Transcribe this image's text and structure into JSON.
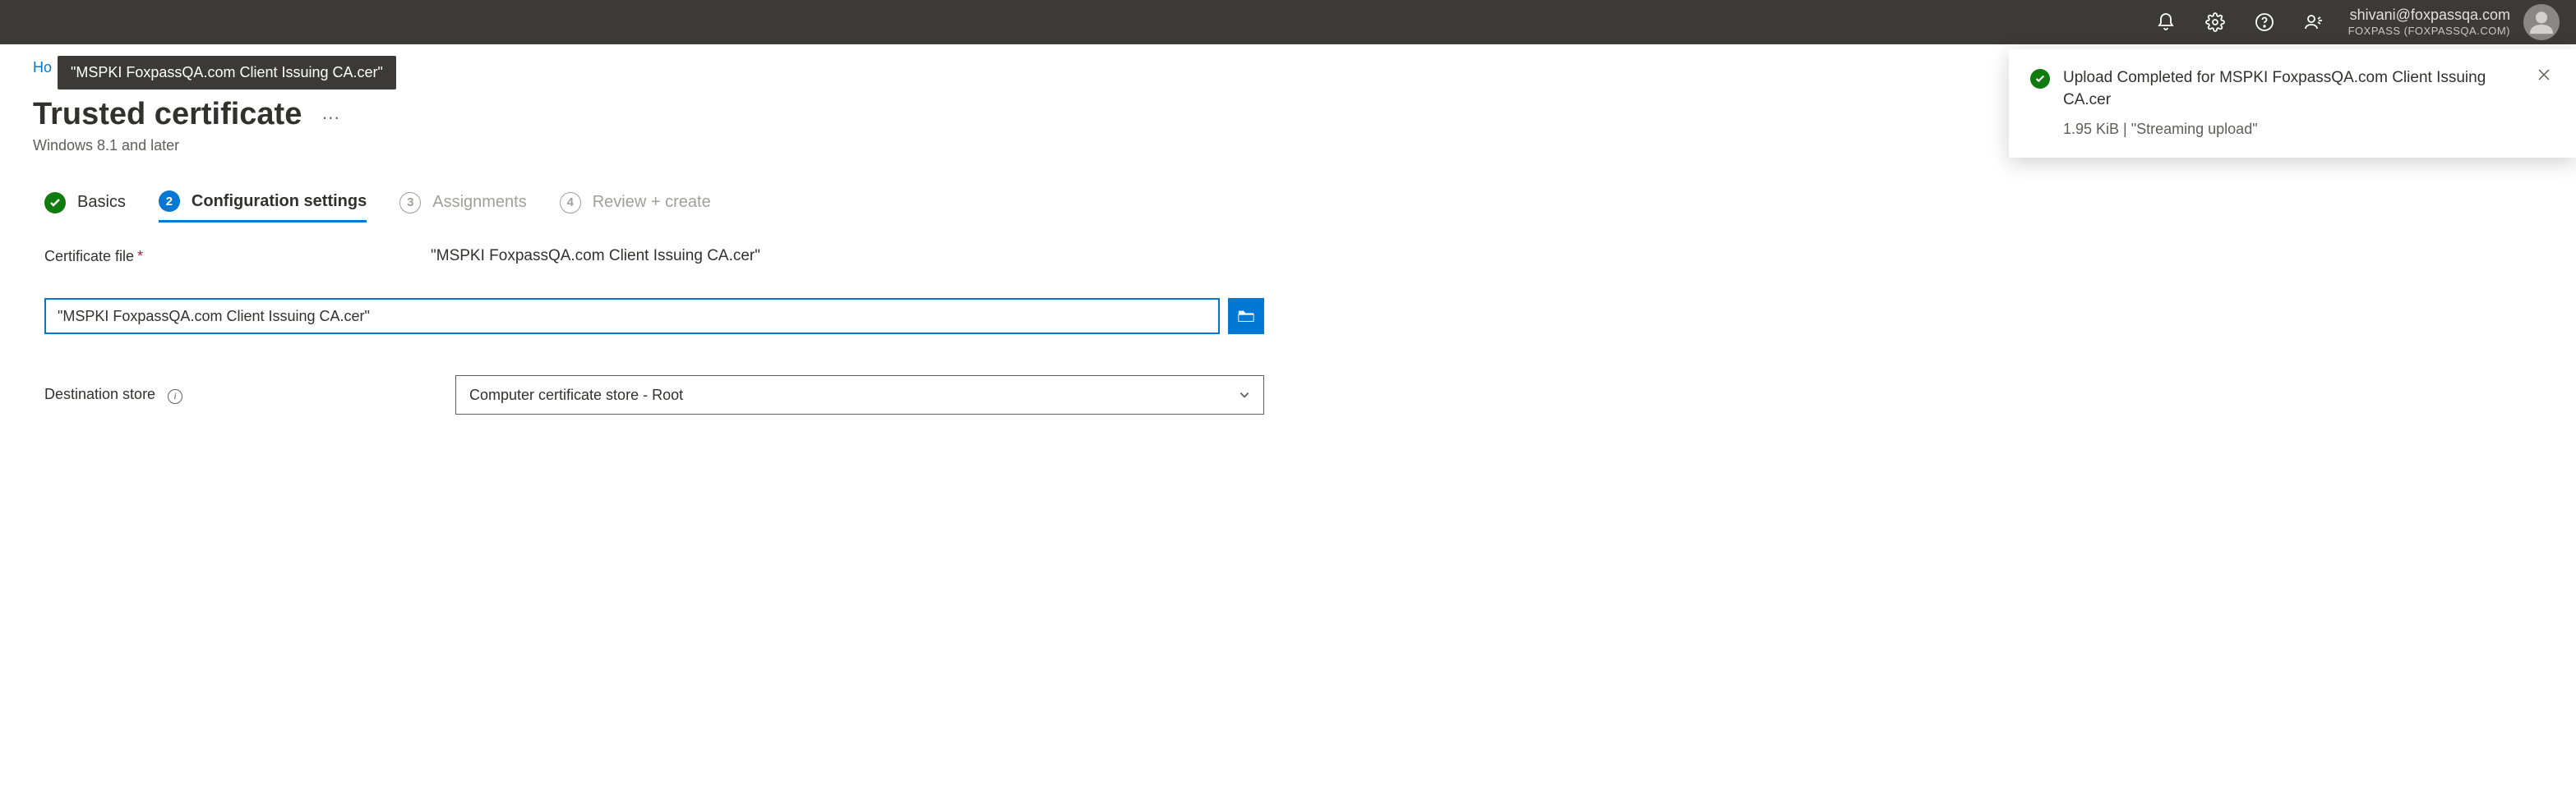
{
  "header": {
    "account_email": "shivani@foxpassqa.com",
    "account_tenant": "FOXPASS (FOXPASSQA.COM)"
  },
  "breadcrumb": {
    "home_label": "Ho",
    "tooltip": "\"MSPKI FoxpassQA.com Client Issuing CA.cer\""
  },
  "title": {
    "main": "Trusted certificate",
    "subtitle": "Windows 8.1 and later"
  },
  "wizard": {
    "steps": [
      {
        "label": "Basics"
      },
      {
        "label": "Configuration settings",
        "num": "2"
      },
      {
        "label": "Assignments",
        "num": "3"
      },
      {
        "label": "Review + create",
        "num": "4"
      }
    ]
  },
  "form": {
    "cert_file_label": "Certificate file",
    "cert_file_name_display": "\"MSPKI FoxpassQA.com Client Issuing CA.cer\"",
    "cert_file_input_value": "\"MSPKI FoxpassQA.com Client Issuing CA.cer\"",
    "dest_store_label": "Destination store",
    "dest_store_value": "Computer certificate store - Root"
  },
  "toast": {
    "message": "Upload Completed for MSPKI FoxpassQA.com Client Issuing CA.cer",
    "detail": "1.95 KiB | \"Streaming upload\""
  }
}
